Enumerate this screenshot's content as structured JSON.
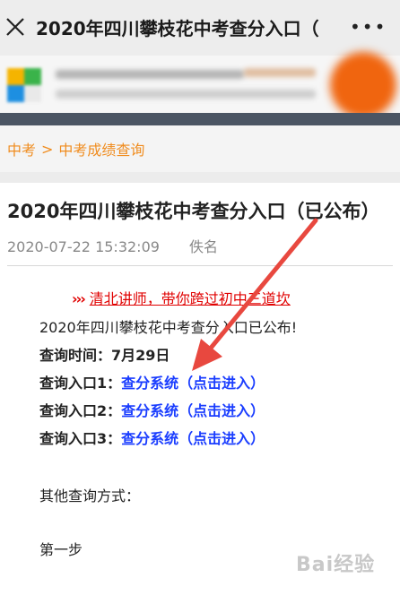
{
  "titlebar": {
    "title": "2020年四川攀枝花中考查分入口（",
    "more": "•••"
  },
  "breadcrumb": {
    "items": [
      "中考",
      "中考成绩查询"
    ],
    "separator": ">"
  },
  "article": {
    "title": "2020年四川攀枝花中考查分入口（已公布）",
    "datetime": "2020-07-22 15:32:09",
    "author": "佚名",
    "promo": "清北讲师，带你跨过初中三道坎",
    "promo_arrows": "›››",
    "intro": "2020年四川攀枝花中考查分入口已公布!",
    "query_time_label": "查询时间：",
    "query_time_value": "7月29日",
    "entries": [
      {
        "label": "查询入口1：",
        "link": "查分系统（点击进入）"
      },
      {
        "label": "查询入口2：",
        "link": "查分系统（点击进入）"
      },
      {
        "label": "查询入口3：",
        "link": "查分系统（点击进入）"
      }
    ],
    "other_methods": "其他查询方式：",
    "step1": "第一步"
  },
  "watermark": "Bai经验",
  "colors": {
    "accent": "#f08c1e",
    "link": "#1a3dff",
    "promo": "#e00000",
    "arrow": "#e8483f"
  }
}
